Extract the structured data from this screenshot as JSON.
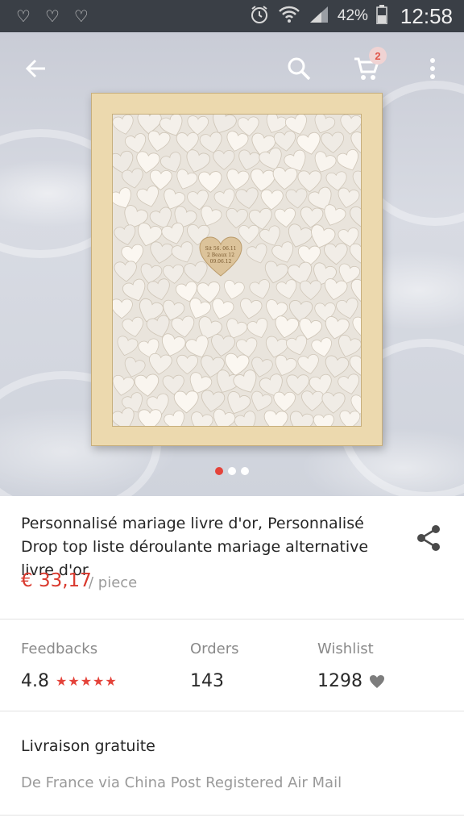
{
  "status_bar": {
    "left_icons": [
      "heart-outline-icon",
      "heart-outline-icon",
      "heart-outline-icon"
    ],
    "right_icons": [
      "alarm-icon",
      "wifi-icon",
      "signal-icon",
      "battery-icon"
    ],
    "battery_pct": "42%",
    "time": "12:58"
  },
  "header": {
    "back_icon": "arrow-left-icon",
    "search_icon": "search-icon",
    "cart_icon": "cart-icon",
    "cart_count": "2",
    "more_icon": "more-vertical-icon"
  },
  "gallery": {
    "heart_text": [
      "Sit 56. 06.11",
      "2 Beaux 12",
      "09.06.12"
    ],
    "dots_total": 3,
    "active_dot": 0
  },
  "product": {
    "title": "Personnalisé mariage livre d'or, Personnalisé Drop top liste déroulante mariage alternative livre d'or",
    "price": "€ 33,17",
    "price_unit": "/ piece",
    "share_icon": "share-icon"
  },
  "stats": {
    "feedbacks_label": "Feedbacks",
    "feedbacks_value": "4.8",
    "stars": "★★★★★",
    "orders_label": "Orders",
    "orders_value": "143",
    "wishlist_label": "Wishlist",
    "wishlist_value": "1298",
    "wishlist_icon": "heart-icon"
  },
  "delivery": {
    "title": "Livraison gratuite",
    "subtitle": "De France via China Post Registered Air Mail"
  },
  "colors": {
    "accent_red": "#e4433a",
    "price_red": "#d9392d",
    "status_bar_bg": "#3a3f46"
  }
}
